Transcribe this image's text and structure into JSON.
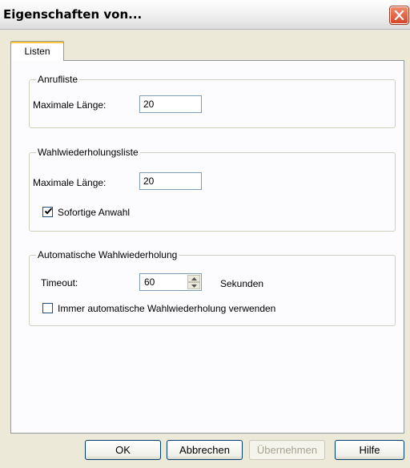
{
  "window": {
    "title": "Eigenschaften von...",
    "close_icon": "close-x-icon",
    "accent_close": "#d6452a"
  },
  "tabs": [
    {
      "label": "Listen",
      "selected": true
    }
  ],
  "groups": {
    "call_list": {
      "title": "Anrufliste",
      "max_length_label": "Maximale Länge:",
      "max_length_value": "20"
    },
    "redial_list": {
      "title": "Wahlwiederholungsliste",
      "max_length_label": "Maximale Länge:",
      "max_length_value": "20",
      "instant_dial_label": "Sofortige Anwahl",
      "instant_dial_checked": true
    },
    "auto_redial": {
      "title": "Automatische Wahlwiederholung",
      "timeout_label": "Timeout:",
      "timeout_value": "60",
      "timeout_unit": "Sekunden",
      "always_label": "Immer automatische Wahlwiederholung verwenden",
      "always_checked": false
    }
  },
  "buttons": {
    "ok": "OK",
    "cancel": "Abbrechen",
    "apply": "Übernehmen",
    "help": "Hilfe"
  }
}
